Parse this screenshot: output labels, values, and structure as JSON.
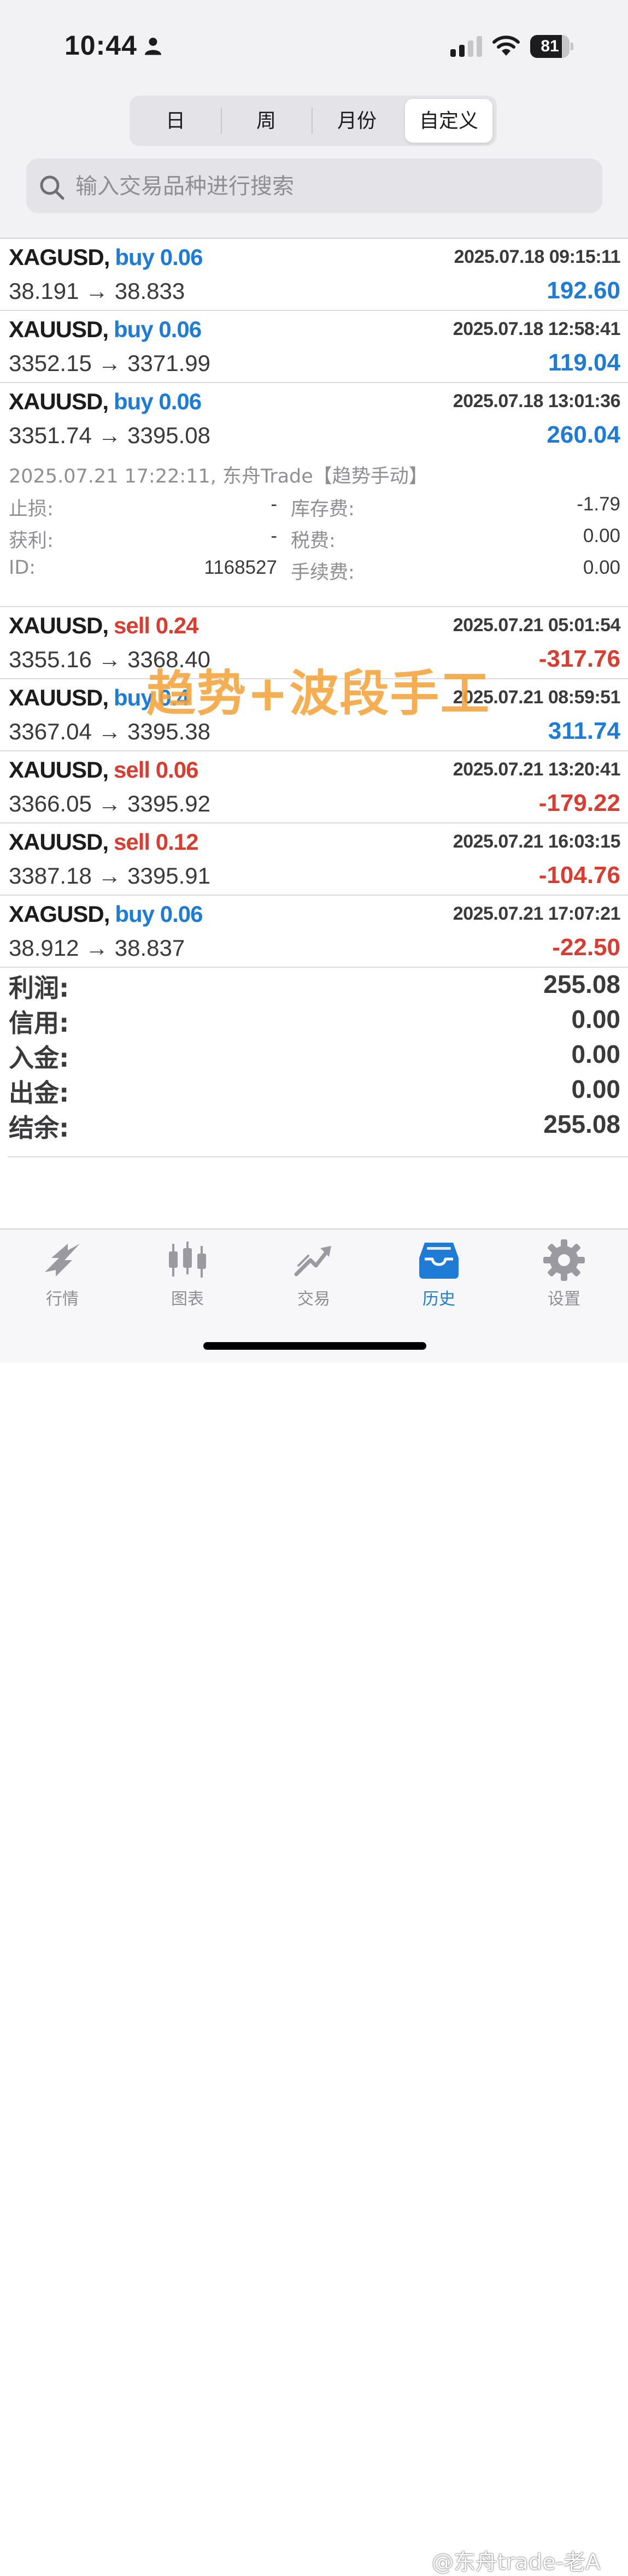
{
  "status_bar": {
    "time": "10:44",
    "battery": "81",
    "battery_level": 0.81
  },
  "segmented": [
    {
      "label": "日",
      "active": false
    },
    {
      "label": "周",
      "active": false
    },
    {
      "label": "月份",
      "active": false
    },
    {
      "label": "自定义",
      "active": true
    }
  ],
  "search": {
    "placeholder": "输入交易品种进行搜索",
    "value": ""
  },
  "trades": [
    {
      "symbol": "XAGUSD",
      "comma": ",",
      "side": "buy",
      "qty": "0.06",
      "datetime": "2025.07.18 09:15:11",
      "prices": "38.191 → 38.833",
      "pnl": "192.60"
    },
    {
      "symbol": "XAUUSD",
      "comma": ",",
      "side": "buy",
      "qty": "0.06",
      "datetime": "2025.07.18 12:58:41",
      "prices": "3352.15 → 3371.99",
      "pnl": "119.04"
    },
    {
      "symbol": "XAUUSD",
      "comma": ",",
      "side": "buy",
      "qty": "0.06",
      "datetime": "2025.07.18 13:01:36",
      "prices": "3351.74 → 3395.08",
      "pnl": "260.04"
    },
    {
      "symbol": "XAUUSD",
      "comma": ",",
      "side": "sell",
      "qty": "0.24",
      "datetime": "2025.07.21 05:01:54",
      "prices": "3355.16 → 3368.40",
      "pnl": "-317.76"
    },
    {
      "symbol": "XAUUSD",
      "comma": ",",
      "side": "buy",
      "qty": "0.4",
      "datetime": "2025.07.21 08:59:51",
      "prices": "3367.04 → 3395.38",
      "pnl": "311.74"
    },
    {
      "symbol": "XAUUSD",
      "comma": ",",
      "side": "sell",
      "qty": "0.06",
      "datetime": "2025.07.21 13:20:41",
      "prices": "3366.05 → 3395.92",
      "pnl": "-179.22"
    },
    {
      "symbol": "XAUUSD",
      "comma": ",",
      "side": "sell",
      "qty": "0.12",
      "datetime": "2025.07.21 16:03:15",
      "prices": "3387.18 → 3395.91",
      "pnl": "-104.76"
    },
    {
      "symbol": "XAGUSD",
      "comma": ",",
      "side": "buy",
      "qty": "0.06",
      "datetime": "2025.07.21 17:07:21",
      "prices": "38.912 → 38.837",
      "pnl": "-22.50"
    }
  ],
  "details": {
    "line": "2025.07.21 17:22:11, 东舟Trade【趋势手动】",
    "stop_loss_label": "止损:",
    "stop_loss": "-",
    "take_profit_label": "获利:",
    "take_profit": "-",
    "id_label": "ID:",
    "id": "1168527",
    "swap_label": "库存费:",
    "swap": "-1.79",
    "tax_label": "税费:",
    "tax": "0.00",
    "commission_label": "手续费:",
    "commission": "0.00"
  },
  "watermark": "趋势+波段手工",
  "summary": [
    {
      "label": "利润:",
      "value": "255.08"
    },
    {
      "label": "信用:",
      "value": "0.00"
    },
    {
      "label": "入金:",
      "value": "0.00"
    },
    {
      "label": "出金:",
      "value": "0.00"
    },
    {
      "label": "结余:",
      "value": "255.08"
    }
  ],
  "tabs": [
    {
      "label": "行情",
      "icon": "quotes-icon",
      "active": false
    },
    {
      "label": "图表",
      "icon": "candlestick-chart-icon",
      "active": false
    },
    {
      "label": "交易",
      "icon": "trade-icon",
      "active": false
    },
    {
      "label": "历史",
      "icon": "history-inbox-icon",
      "active": true
    },
    {
      "label": "设置",
      "icon": "gear-icon",
      "active": false
    }
  ],
  "credit": "@东舟trade-老A",
  "colors": {
    "buy": "#1e7bd6",
    "sell": "#d93c30",
    "accent": "#1e7bd6",
    "watermark": "#f5a33c"
  }
}
